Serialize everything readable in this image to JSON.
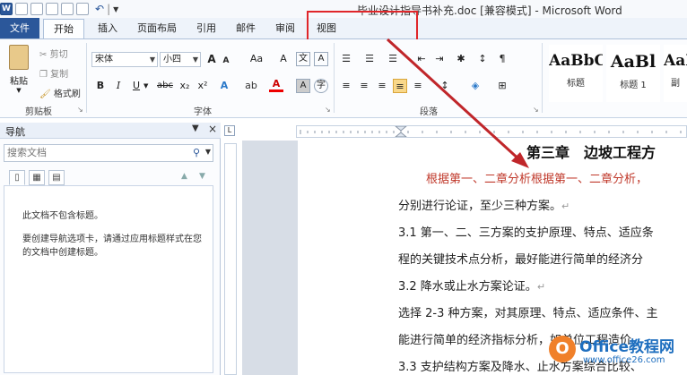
{
  "window": {
    "title": "毕业设计指导书补充.doc [兼容模式] - Microsoft Word",
    "app_icon": "W"
  },
  "ribbon_tabs": [
    "文件",
    "开始",
    "插入",
    "页面布局",
    "引用",
    "邮件",
    "审阅",
    "视图"
  ],
  "clipboard": {
    "paste": "粘贴",
    "cut": "剪切",
    "copy": "复制",
    "format_painter": "格式刷",
    "group_label": "剪贴板"
  },
  "font": {
    "font_name": "宋体",
    "font_size": "小四",
    "group_label": "字体",
    "bold": "B",
    "italic": "I",
    "underline": "U",
    "strike": "abc",
    "sub": "x₂",
    "sup": "x²",
    "grow": "A",
    "shrink": "A",
    "case": "Aa",
    "clear": "A",
    "color": "A",
    "ab": "A"
  },
  "paragraph": {
    "group_label": "段落"
  },
  "styles": [
    {
      "preview": "AaBbC",
      "name": "标题"
    },
    {
      "preview": "AaBl",
      "name": "标题 1"
    },
    {
      "preview": "AaB",
      "name": "副"
    }
  ],
  "navigation": {
    "title": "导航",
    "search_placeholder": "搜索文档",
    "empty_message": "此文档不包含标题。",
    "help_message": "要创建导航选项卡，请通过应用标题样式在您的文档中创建标题。"
  },
  "ruler": {
    "tab_marker": "L"
  },
  "document": {
    "chapter_title": "第三章　边坡工程方",
    "lines": [
      "根据第一、二章分析根据第一、二章分析，",
      "分别进行论证，至少三种方案。",
      "3.1  第一、二、三方案的支护原理、特点、适应条",
      "程的关键技术点分析，最好能进行简单的经济分",
      "3.2  降水或止水方案论证。",
      "选择 2-3 种方案，对其原理、特点、适应条件、主",
      "能进行简单的经济指标分析，如单位工程造价",
      "3.3  支护结构方案及降水、止水方案综合比较、"
    ]
  },
  "watermark": {
    "name": "Office教程网",
    "url": "www.office26.com",
    "logo": "O"
  },
  "colors": {
    "accent": "#2b579a",
    "highlight": "#e0262a",
    "red_text": "#c0392b"
  }
}
